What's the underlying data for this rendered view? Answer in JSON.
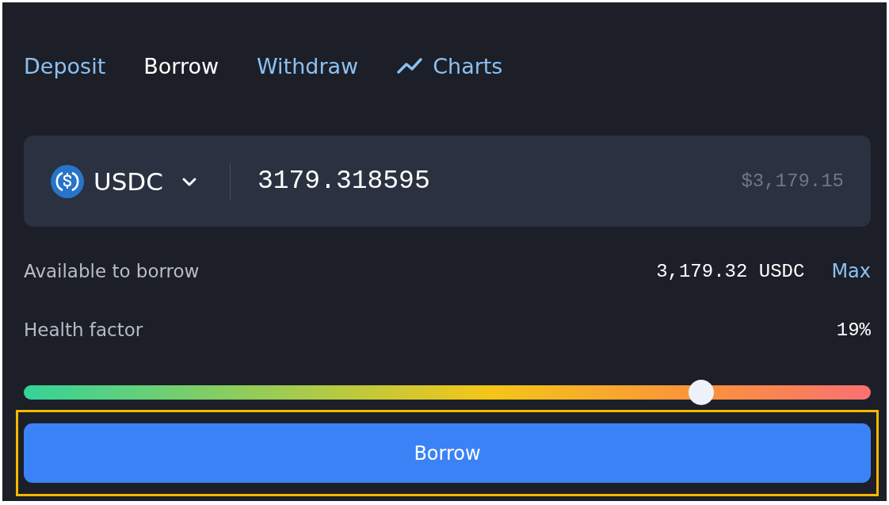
{
  "tabs": [
    {
      "label": "Deposit",
      "selected": false,
      "kind": "text"
    },
    {
      "label": "Borrow",
      "selected": true,
      "kind": "text"
    },
    {
      "label": "Withdraw",
      "selected": false,
      "kind": "text"
    },
    {
      "label": "Charts",
      "selected": false,
      "kind": "chart"
    }
  ],
  "amount_input": {
    "token": "USDC",
    "value": "3179.318595",
    "usd_value": "$3,179.15"
  },
  "available": {
    "label": "Available to borrow",
    "value": "3,179.32 USDC",
    "max_link": "Max"
  },
  "health_factor": {
    "label": "Health factor",
    "value": "19%",
    "level": 0.8
  },
  "borrow_button": {
    "label": "Borrow",
    "highlighted": true
  }
}
